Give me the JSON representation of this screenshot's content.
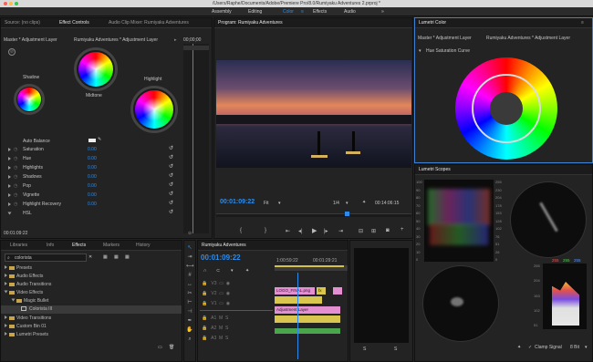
{
  "window": {
    "title": "/Users/Raphe/Documents/Adobe/Premiere Pro/8.0/Rumiyaku Adventures 2.prproj *"
  },
  "workspaces": {
    "items": [
      "Assembly",
      "Editing",
      "Color",
      "Effects",
      "Audio"
    ],
    "active": "Color"
  },
  "effect_controls": {
    "tabs": [
      "Source: (no clips)",
      "Effect Controls",
      "Audio Clip Mixer: Rumiyaku Adventures"
    ],
    "source_clip": "Master * Adjustment Layer",
    "target_clip": "Rumiyaku Adventures * Adjustment Layer",
    "mini_timecode": "00;00;00",
    "wheels": {
      "shadow": "Shadow",
      "midtone": "Midtone",
      "highlight": "Highlight"
    },
    "auto_balance": "Auto Balance",
    "properties": [
      {
        "name": "Saturation",
        "value": "0.00"
      },
      {
        "name": "Hue",
        "value": "0.00"
      },
      {
        "name": "Highlights",
        "value": "0.00"
      },
      {
        "name": "Shadows",
        "value": "0.00"
      },
      {
        "name": "Pop",
        "value": "0.00"
      },
      {
        "name": "Vignette",
        "value": "0.00"
      },
      {
        "name": "Highlight Recovery",
        "value": "0.00"
      },
      {
        "name": "HSL",
        "value": ""
      }
    ],
    "timecode": "00:01:09:22"
  },
  "program_monitor": {
    "title": "Program: Rumiyaku Adventures",
    "current_time": "00:01:09:22",
    "fit": "Fit",
    "resolution": "1/4",
    "duration": "00:14:06:15"
  },
  "lumetri_color": {
    "title": "Lumetri Color",
    "source_clip": "Master * Adjustment Layer",
    "target_clip": "Rumiyaku Adventures * Adjustment Layer",
    "section": "Hue Saturation Curve"
  },
  "lumetri_scopes": {
    "title": "Lumetri Scopes",
    "left_axis": [
      "100",
      "90",
      "80",
      "70",
      "60",
      "50",
      "40",
      "30",
      "20",
      "10",
      "0"
    ],
    "right_axis": [
      "255",
      "230",
      "204",
      "178",
      "153",
      "128",
      "102",
      "76",
      "51",
      "26",
      "0"
    ],
    "rgb_readout": [
      "255",
      "255",
      "255"
    ],
    "histogram_axis": [
      "255",
      "204",
      "153",
      "102",
      "51"
    ],
    "clamp_signal": "Clamp Signal",
    "bit_depth": "8 Bit"
  },
  "effects_panel": {
    "tabs": [
      "Libraries",
      "Info",
      "Effects",
      "Markers",
      "History"
    ],
    "search_value": "colorista",
    "tree": [
      {
        "label": "Presets",
        "level": 0,
        "expanded": false
      },
      {
        "label": "Audio Effects",
        "level": 0,
        "expanded": false
      },
      {
        "label": "Audio Transitions",
        "level": 0,
        "expanded": false
      },
      {
        "label": "Video Effects",
        "level": 0,
        "expanded": true
      },
      {
        "label": "Magic Bullet",
        "level": 1,
        "expanded": true
      },
      {
        "label": "Colorista III",
        "level": 2,
        "expanded": false
      },
      {
        "label": "Video Transitions",
        "level": 0,
        "expanded": false
      },
      {
        "label": "Custom Bin 01",
        "level": 0,
        "expanded": false
      },
      {
        "label": "Lumetri Presets",
        "level": 0,
        "expanded": false
      }
    ]
  },
  "timeline": {
    "title": "Rumiyaku Adventures",
    "timecode": "00:01:09:22",
    "ruler": [
      "1:00:59:22",
      "00:01:29:21"
    ],
    "video_tracks": [
      "V3",
      "V2",
      "V1"
    ],
    "audio_tracks": [
      "A1",
      "A2",
      "A3"
    ],
    "clips": [
      {
        "label": "LOGO_FINAL.png",
        "color": "#e58fd3"
      },
      {
        "label": "Adjustment Layer",
        "color": "#e58fd3"
      },
      {
        "label": "fx",
        "color": "#d9c64f"
      }
    ]
  },
  "audio_meter": {
    "labels": [
      "S",
      "S"
    ]
  }
}
